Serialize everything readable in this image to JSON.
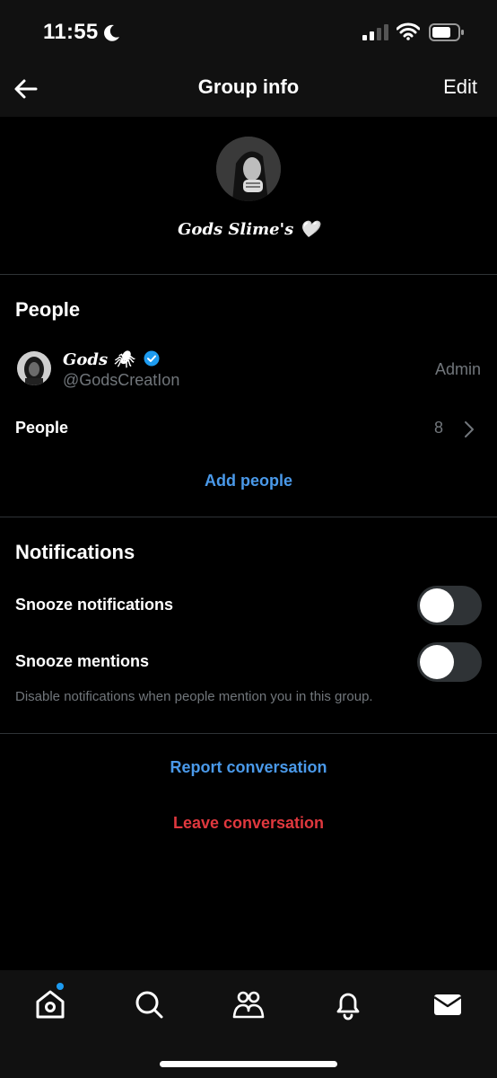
{
  "status_bar": {
    "time": "11:55"
  },
  "header": {
    "title": "Group info",
    "edit_label": "Edit"
  },
  "group": {
    "name": "Gods Slime's 🤍"
  },
  "people_section": {
    "title": "People",
    "members": [
      {
        "name": "Gods 🕷",
        "handle": "@GodsCreatIon",
        "role": "Admin",
        "verified": true
      }
    ],
    "people_label": "People",
    "people_count": "8",
    "add_people_label": "Add people"
  },
  "notifications_section": {
    "title": "Notifications",
    "snooze_notifications_label": "Snooze notifications",
    "snooze_notifications_on": false,
    "snooze_mentions_label": "Snooze mentions",
    "snooze_mentions_on": false,
    "mentions_hint": "Disable notifications when people mention you in this group."
  },
  "actions": {
    "report_label": "Report conversation",
    "leave_label": "Leave conversation"
  },
  "tab_bar": {
    "tabs": [
      "home-icon",
      "search-icon",
      "communities-icon",
      "notifications-icon",
      "messages-icon"
    ],
    "home_has_badge": true
  },
  "colors": {
    "accent_blue": "#4a99e9",
    "danger_red": "#e0383e",
    "muted_text": "#71767b",
    "verified_blue": "#1d9bf0"
  }
}
